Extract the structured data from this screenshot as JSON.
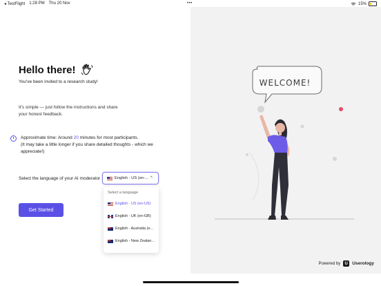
{
  "statusbar": {
    "app": "◂ TestFlight",
    "time": "1:28 PM",
    "date": "Thu 20 Nov",
    "dots": "•••",
    "battery": "15%"
  },
  "intro": {
    "title": "Hello there!",
    "subtitle": "You've been invited to a research study!",
    "body": "It's simple — just follow the instructions and share your honest feedback."
  },
  "time": {
    "prefix": "Approximate time: Around ",
    "minutes": "20",
    "suffix": " minutes for most participants.",
    "note": "(It may take a little longer if you share detailed thoughts - which we appreciate!)"
  },
  "language": {
    "label": "Select the language of your AI moderator",
    "selected": "English - US (en-...",
    "dropdown_header": "Select a language",
    "options": [
      "English - US (en-US)",
      "English - UK (en-GB)",
      "English - Australia (e...",
      "English - New Zealan..."
    ]
  },
  "cta": {
    "label": "Get Started"
  },
  "illustration": {
    "sign_text": "WELCOME!"
  },
  "footer": {
    "powered_by": "Powered by",
    "brand": "Userology",
    "logo_letter": "U"
  },
  "colors": {
    "accent": "#5b50e6",
    "panel_bg": "#f2f2f2",
    "dot_pink": "#e84a6a"
  }
}
